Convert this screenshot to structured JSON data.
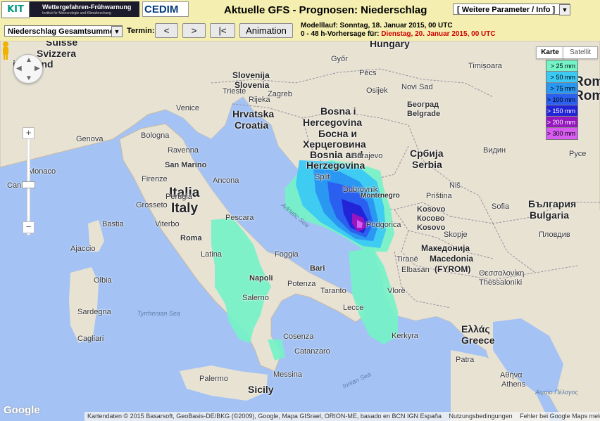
{
  "header": {
    "kit_logo": "KIT",
    "banner_title": "Wettergefahren-Frühwarnung",
    "banner_subtitle": "Institut für Meteorologie und Klimaforschung",
    "cedim_logo": "CEDIM",
    "page_title": "Aktuelle GFS - Prognosen: Niederschlag",
    "param_select": "[ Weitere Parameter / Info ]"
  },
  "controls": {
    "variable_select": "Niederschlag Gesamtsumme",
    "termin_label": "Termin:",
    "prev_label": "<",
    "next_label": ">",
    "first_label": "|<",
    "animation_label": "Animation"
  },
  "model_info": {
    "run_line": "Modelllauf: Sonntag, 18. Januar 2015, 00 UTC",
    "forecast_prefix": "0 - 48 h-Vorhersage für: ",
    "forecast_date": "Dienstag, 20. Januar 2015, 00 UTC",
    "highlight_color": "#d00000"
  },
  "map": {
    "type_tabs": [
      "Karte",
      "Satellit"
    ],
    "zoom_in": "+",
    "zoom_out": "−",
    "google_logo": "Google",
    "attribution": "Kartendaten © 2015 Basarsoft, GeoBasis-DE/BKG (©2009), Google, Mapa GISrael, ORION-ME, basado en BCN IGN España",
    "terms": "Nutzungsbedingungen",
    "report": "Fehler bei Google Maps melden",
    "labels": {
      "hungary": "Hungary",
      "suisse": "Suisse",
      "svizzera": "Svizzera",
      "itzerland": "itzerland",
      "slovenija": "Slovenija",
      "slovenia": "Slovenia",
      "hrvatska": "Hrvatska",
      "croatia": "Croatia",
      "bosna1": "Bosna i",
      "bosna2": "Hercegovina",
      "bosna3": "Босна и",
      "bosna4": "Херцеговина",
      "bosna5": "Bosnia and",
      "bosna6": "Herzegovina",
      "srbija": "Србија",
      "serbia": "Serbia",
      "italia": "Italia",
      "italy": "Italy",
      "montenegro1": "Monte",
      "montenegro2": "negro",
      "kosovo1": "Kosovo",
      "kosovo2": "Косово",
      "kosovo3": "Kosovo",
      "mak1": "Македонија",
      "mak2": "Macedonia",
      "mak3": "(FYROM)",
      "bulg1": "България",
      "bulg2": "Bulgaria",
      "greece1": "Ελλάς",
      "greece2": "Greece",
      "romania1": "Rom",
      "romania2": "Rom",
      "monaco": "Monaco",
      "genova": "Genova",
      "bologna": "Bologna",
      "ravenna": "Ravenna",
      "sanmarino": "San Marino",
      "firenze": "Firenze",
      "grosseto": "Grosseto",
      "roma": "Roma",
      "latina": "Latina",
      "pescara": "Pescara",
      "foggia": "Foggia",
      "napoli": "Napoli",
      "salerno": "Salerno",
      "bari": "Bari",
      "lecce": "Lecce",
      "cosenza": "Cosenza",
      "catanzaro": "Catanzaro",
      "palermo": "Palermo",
      "sicily": "Sicily",
      "sardegna": "Sardegna",
      "cagliari": "Cagliari",
      "olbia": "Olbia",
      "ajaccio": "Ajaccio",
      "bastia": "Bastia",
      "cannes": "Cannes",
      "zagreb": "Zagreb",
      "rijeka": "Rijeka",
      "split": "Split",
      "sarajevo": "Sarajevo",
      "beograd1": "Београд",
      "beograd2": "Belgrade",
      "podgorica": "Podgorica",
      "tirana": "Tiranë",
      "skopje": "Skopje",
      "sofia": "Sofia",
      "plovdiv": "Пловдив",
      "thessaloniki": "Θεσσαλονίκη",
      "thessaloniki2": "Thessaloniki",
      "athens": "Αθήνα",
      "athens2": "Athens",
      "patra": "Patra",
      "nis": "Niš",
      "kerkyra": "Kerkyra",
      "adriatic": "Adriatic Sea",
      "tyrrhenian": "Tyrrhenian Sea",
      "ionian": "Ionian Sea",
      "aegean": "Αιγαίο Πέλαγος",
      "dubrovnik": "Dubrovnik",
      "elbasan": "Elbasan",
      "vlore": "Vlorë",
      "pristina": "Priština",
      "ruse": "Русе",
      "vidin": "Видин",
      "messina": "Messina",
      "taranto": "Taranto",
      "potenza": "Potenza",
      "perugia": "Perugia",
      "ancona": "Ancona",
      "viterbo": "Viterbo",
      "venice": "Venice",
      "trieste": "Trieste",
      "osijek": "Osijek",
      "gyor": "Győr",
      "pecs": "Pécs",
      "novisad": "Novi Sad",
      "timisoara": "Timișoara"
    }
  },
  "legend": [
    {
      "label": "> 25 mm",
      "color": "#73f3c6"
    },
    {
      "label": "> 50 mm",
      "color": "#3cc9f4"
    },
    {
      "label": "> 75 mm",
      "color": "#2a98f2"
    },
    {
      "label": "> 100 mm",
      "color": "#2a5ff0"
    },
    {
      "label": "> 150 mm",
      "color": "#2323d8"
    },
    {
      "label": "> 200 mm",
      "color": "#9616c0"
    },
    {
      "label": "> 300 mm",
      "color": "#d85bf2"
    }
  ]
}
